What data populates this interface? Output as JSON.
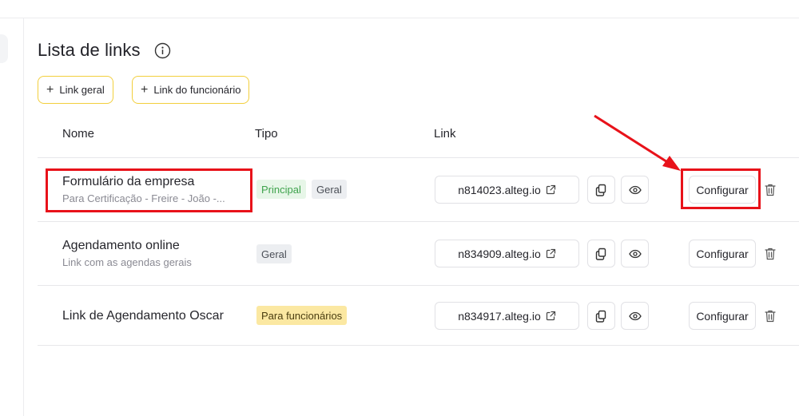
{
  "page": {
    "title": "Lista de links",
    "buttons": {
      "add_general": "Link geral",
      "add_employee": "Link do funcionário"
    }
  },
  "table": {
    "headers": [
      "Nome",
      "Tipo",
      "Link"
    ],
    "rows": [
      {
        "name": "Formulário da empresa",
        "subtitle": "Para Certificação - Freire - João -...",
        "tags": [
          "Principal",
          "Geral"
        ],
        "link": "n814023.alteg.io",
        "configure": "Configurar"
      },
      {
        "name": "Agendamento online",
        "subtitle": "Link com as agendas gerais",
        "tags": [
          "Geral"
        ],
        "link": "n834909.alteg.io",
        "configure": "Configurar"
      },
      {
        "name": "Link de Agendamento Oscar",
        "subtitle": "",
        "tags": [
          "Para funcionários"
        ],
        "link": "n834917.alteg.io",
        "configure": "Configurar"
      }
    ]
  },
  "icons": {
    "info": "info-icon",
    "plus": "plus-icon",
    "external": "external-link-icon",
    "copy": "copy-icon",
    "preview": "eye-icon",
    "delete": "trash-icon"
  },
  "colors": {
    "accent_border": "#f2cf3c",
    "principal_tag_bg": "#e7f6e8",
    "principal_tag_text": "#3fa34d",
    "general_tag_bg": "#eceef1",
    "employee_tag_bg": "#fbe8a2",
    "annotation_red": "#e8121a"
  }
}
